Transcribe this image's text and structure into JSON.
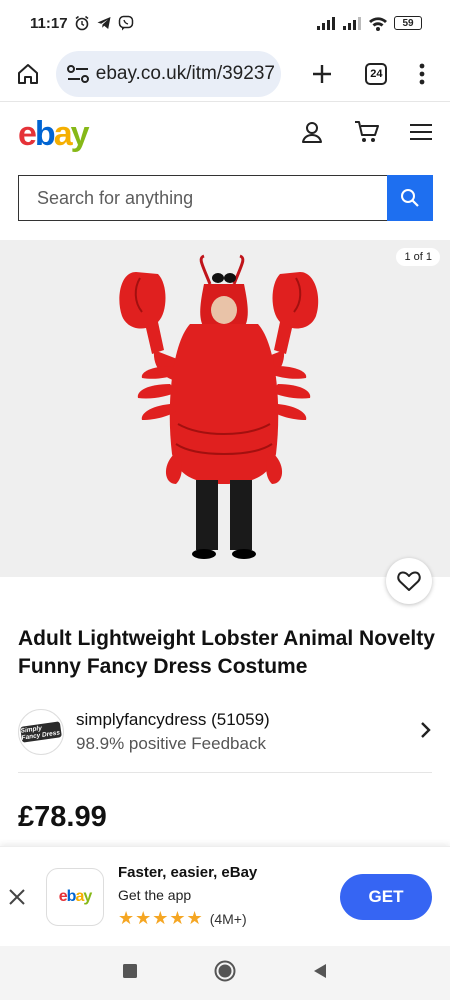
{
  "status_bar": {
    "time": "11:17",
    "battery": "59",
    "icons": [
      "alarm-icon",
      "telegram-icon",
      "viber-icon",
      "signal-icon",
      "signal-icon",
      "wifi-icon",
      "battery-icon"
    ]
  },
  "browser": {
    "url": "ebay.co.uk/itm/39237",
    "tab_count": "24"
  },
  "header": {
    "logo": {
      "e": "e",
      "b": "b",
      "a": "a",
      "y": "y"
    },
    "colors": {
      "red": "#e53238",
      "blue": "#0064d2",
      "yellow": "#f5af02",
      "green": "#86b817"
    }
  },
  "search": {
    "placeholder": "Search for anything"
  },
  "gallery": {
    "counter": "1 of 1"
  },
  "listing": {
    "title": "Adult Lightweight Lobster Animal Novelty Funny Fancy Dress Costume",
    "price": "£78.99"
  },
  "seller": {
    "name": "simplyfancydress (51059)",
    "feedback": "98.9% positive Feedback",
    "avatar_text": "Simply Fancy Dress"
  },
  "app_banner": {
    "logo": "ebay",
    "title": "Faster, easier, eBay",
    "subtitle": "Get the app",
    "stars": "★★★★★",
    "rating_count": "(4M+)",
    "get_label": "GET",
    "accent": "#3665f3"
  }
}
